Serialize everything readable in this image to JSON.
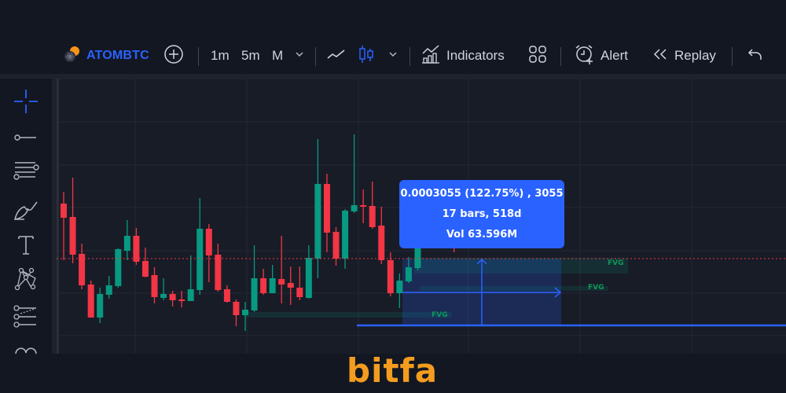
{
  "toolbar": {
    "symbol": "ATOMBTC",
    "timeframes": [
      "1m",
      "5m",
      "M"
    ],
    "active_timeframe": "M",
    "indicators_label": "Indicators",
    "alert_label": "Alert",
    "replay_label": "Replay"
  },
  "drawing_tools": [
    "crosshair-icon",
    "trend-line-icon",
    "fib-retracement-icon",
    "brush-icon",
    "text-icon",
    "pattern-icon",
    "prediction-icon",
    "curve-icon"
  ],
  "measure_tooltip": {
    "line1": "0.0003055 (122.75%) , 3055",
    "line2": "17 bars, 518d",
    "line3": "Vol 63.596M"
  },
  "fvg_labels": [
    "FVG",
    "FVG",
    "FVG"
  ],
  "logo": {
    "text": "bitfa"
  },
  "colors": {
    "up": "#089981",
    "down": "#f23645",
    "accent": "#2962ff",
    "fvg_text": "#0d9a5a",
    "logo": "#f39c1f"
  },
  "chart_data": {
    "type": "candlestick",
    "note": "relative price levels (higher = higher price), read from screen",
    "candles": [
      {
        "o": 70,
        "c": 52,
        "h": 85,
        "l": -2
      },
      {
        "o": 53,
        "c": 5,
        "h": 103,
        "l": -6
      },
      {
        "o": 6,
        "c": -34,
        "h": 19,
        "l": -39
      },
      {
        "o": -33,
        "c": -75,
        "h": -28,
        "l": -75
      },
      {
        "o": -75,
        "c": -45,
        "h": -37,
        "l": -82
      },
      {
        "o": -46,
        "c": -34,
        "h": -22,
        "l": -51
      },
      {
        "o": -35,
        "c": 12,
        "h": 13,
        "l": -37
      },
      {
        "o": 10,
        "c": 29,
        "h": 49,
        "l": -2
      },
      {
        "o": 29,
        "c": -4,
        "h": 39,
        "l": -8
      },
      {
        "o": -3,
        "c": -23,
        "h": 14,
        "l": -24
      },
      {
        "o": -21,
        "c": -49,
        "h": -11,
        "l": -57
      },
      {
        "o": -50,
        "c": -45,
        "h": -25,
        "l": -53
      },
      {
        "o": -45,
        "c": -53,
        "h": -41,
        "l": -61
      },
      {
        "o": -52,
        "c": -54,
        "h": -41,
        "l": -62
      },
      {
        "o": -54,
        "c": -39,
        "h": 4,
        "l": -54
      },
      {
        "o": -40,
        "c": 38,
        "h": 77,
        "l": -46
      },
      {
        "o": 38,
        "c": 4,
        "h": 44,
        "l": -30
      },
      {
        "o": 5,
        "c": -40,
        "h": 19,
        "l": -42
      },
      {
        "o": -39,
        "c": -55,
        "h": -34,
        "l": -56
      },
      {
        "o": -55,
        "c": -72,
        "h": -52,
        "l": -86
      },
      {
        "o": -72,
        "c": -65,
        "h": -55,
        "l": -92
      },
      {
        "o": -66,
        "c": -25,
        "h": 17,
        "l": -68
      },
      {
        "o": -25,
        "c": -44,
        "h": -13,
        "l": -46
      },
      {
        "o": -44,
        "c": -25,
        "h": -8,
        "l": -44
      },
      {
        "o": -26,
        "c": -33,
        "h": 29,
        "l": -57
      },
      {
        "o": -31,
        "c": -37,
        "h": -10,
        "l": -59
      },
      {
        "o": -37,
        "c": -49,
        "h": -10,
        "l": -53
      },
      {
        "o": -50,
        "c": 1,
        "h": 17,
        "l": -51
      },
      {
        "o": 0,
        "c": 95,
        "h": 152,
        "l": -25
      },
      {
        "o": 95,
        "c": 33,
        "h": 108,
        "l": 8
      },
      {
        "o": 34,
        "c": 0,
        "h": 40,
        "l": -9
      },
      {
        "o": 0,
        "c": 61,
        "h": 63,
        "l": -13
      },
      {
        "o": 60,
        "c": 68,
        "h": 158,
        "l": 58
      },
      {
        "o": 68,
        "c": 66,
        "h": 88,
        "l": 45
      },
      {
        "o": 67,
        "c": 40,
        "h": 98,
        "l": 38
      },
      {
        "o": 42,
        "c": -2,
        "h": 66,
        "l": -7
      },
      {
        "o": -2,
        "c": -44,
        "h": 8,
        "l": -48
      },
      {
        "o": -44,
        "c": -28,
        "h": -19,
        "l": -63
      },
      {
        "o": -29,
        "c": -11,
        "h": 2,
        "l": -31
      },
      {
        "o": -12,
        "c": 30,
        "h": 35,
        "l": -15
      },
      {
        "o": 30,
        "c": 35,
        "h": 40,
        "l": 28
      },
      {
        "o": 33,
        "c": 36,
        "h": 45,
        "l": 30
      },
      {
        "o": 36,
        "c": 30,
        "h": 45,
        "l": 28
      },
      {
        "o": 32,
        "c": 20,
        "h": 36,
        "l": 8
      }
    ]
  }
}
